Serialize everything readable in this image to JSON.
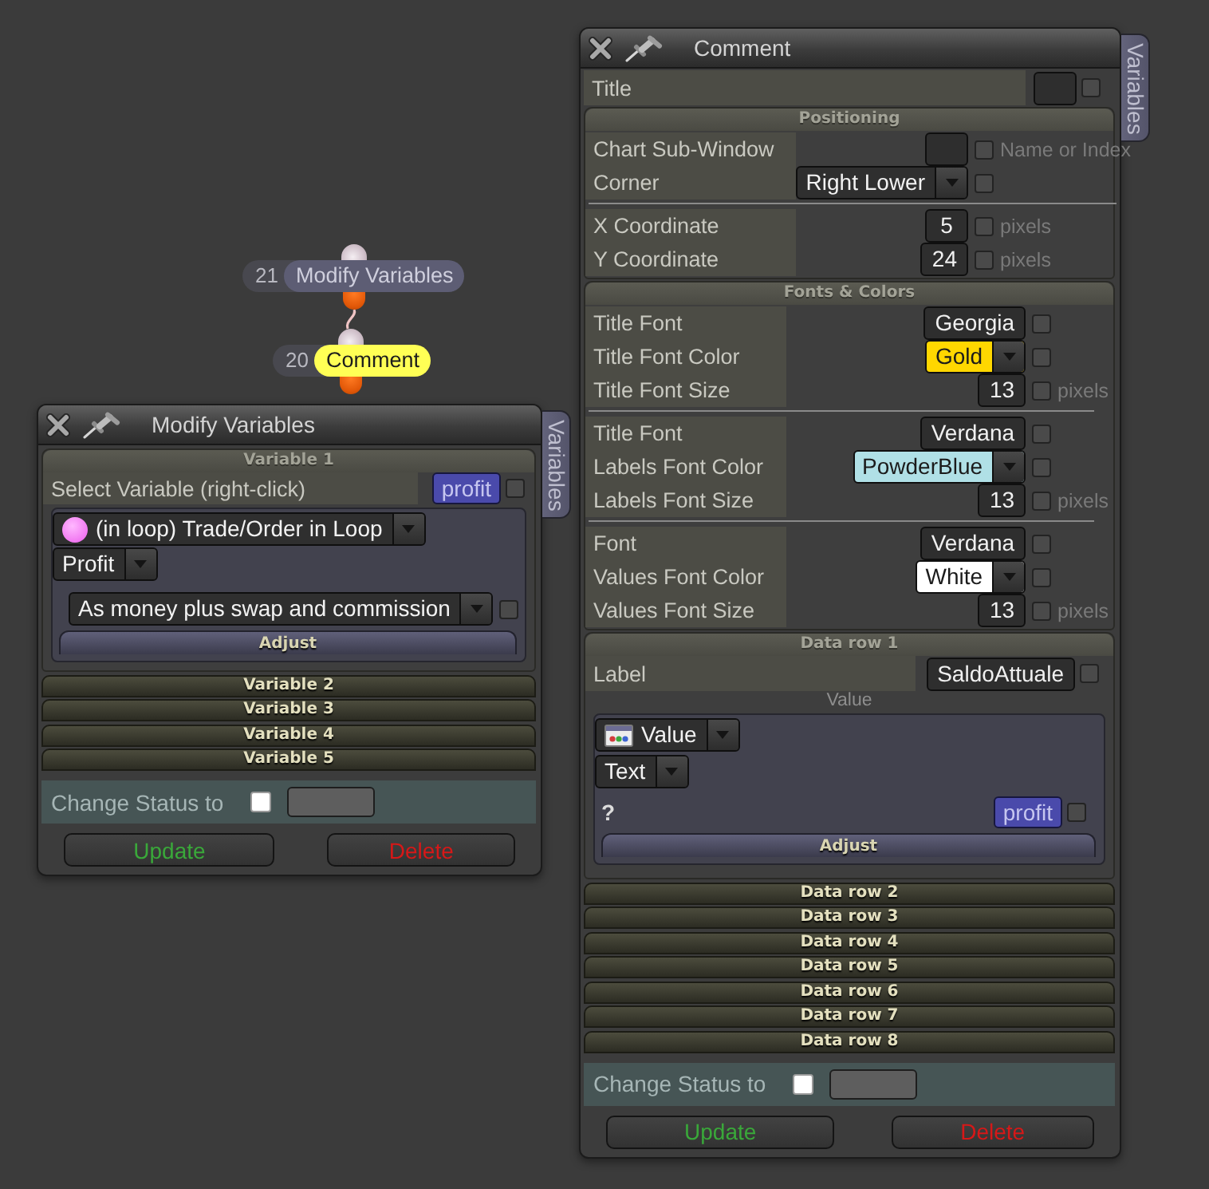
{
  "canvas_nodes": [
    {
      "number": "21",
      "label": "Modify Variables",
      "selected": false
    },
    {
      "number": "20",
      "label": "Comment",
      "selected": true
    }
  ],
  "modify_variables_window": {
    "title": "Modify Variables",
    "side_tab": "Variables",
    "sections": [
      {
        "kind": "variable",
        "title": "Variable 1",
        "expanded": true,
        "select_label": "Select Variable (right-click)",
        "variable": "profit",
        "variable_checked": false,
        "source": "(in loop) Trade/Order in Loop",
        "property": "Profit",
        "mode": "As money plus swap and commission",
        "mode_checked": false,
        "adjust": "Adjust"
      },
      {
        "kind": "variable",
        "title": "Variable 2",
        "expanded": false
      },
      {
        "kind": "variable",
        "title": "Variable 3",
        "expanded": false
      },
      {
        "kind": "variable",
        "title": "Variable 4",
        "expanded": false
      },
      {
        "kind": "variable",
        "title": "Variable 5",
        "expanded": false
      }
    ],
    "status": {
      "label": "Change Status to",
      "checked": false
    },
    "buttons": [
      {
        "label": "Update",
        "kind": "update"
      },
      {
        "label": "Delete",
        "kind": "delete"
      }
    ]
  },
  "comment_window": {
    "title": "Comment",
    "side_tab": "Variables",
    "title_row": {
      "label": "Title",
      "checked": false
    },
    "sections": [
      {
        "kind": "settings",
        "title": "Positioning",
        "expanded": true,
        "groups": [
          {
            "rows": [
              {
                "label": "Chart Sub-Window",
                "kind": "field",
                "note": "Name or Index",
                "checked": false
              },
              {
                "label": "Corner",
                "kind": "dropdown",
                "value": "Right Lower",
                "checked": false
              }
            ]
          },
          {
            "rows": [
              {
                "label": "X Coordinate",
                "kind": "field",
                "value": "5",
                "note": "pixels",
                "checked": false
              },
              {
                "label": "Y Coordinate",
                "kind": "field",
                "value": "24",
                "note": "pixels",
                "checked": false
              }
            ]
          }
        ]
      },
      {
        "kind": "settings",
        "title": "Fonts & Colors",
        "expanded": true,
        "groups": [
          {
            "rows": [
              {
                "label": "Title Font",
                "kind": "field",
                "value": "Georgia",
                "checked": false
              },
              {
                "label": "Title Font Color",
                "kind": "color",
                "value": "Gold",
                "color": "#ffd700",
                "checked": false
              },
              {
                "label": "Title Font Size",
                "kind": "field",
                "value": "13",
                "note": "pixels",
                "checked": false
              }
            ]
          },
          {
            "rows": [
              {
                "label": "Title Font",
                "kind": "field",
                "value": "Verdana",
                "checked": false
              },
              {
                "label": "Labels Font Color",
                "kind": "color",
                "value": "PowderBlue",
                "color": "#b0e0e6",
                "checked": false
              },
              {
                "label": "Labels Font Size",
                "kind": "field",
                "value": "13",
                "note": "pixels",
                "checked": false
              }
            ]
          },
          {
            "rows": [
              {
                "label": "Font",
                "kind": "field",
                "value": "Verdana",
                "checked": false
              },
              {
                "label": "Values Font Color",
                "kind": "color",
                "value": "White",
                "color": "#ffffff",
                "checked": false
              },
              {
                "label": "Values Font Size",
                "kind": "field",
                "value": "13",
                "note": "pixels",
                "checked": false
              }
            ]
          }
        ]
      },
      {
        "kind": "data_row",
        "title": "Data row 1",
        "expanded": true,
        "label_row": {
          "label": "Label",
          "value": "SaldoAttuale",
          "checked": false
        },
        "value_caption": "Value",
        "source": "Value",
        "type": "Text",
        "question": "?",
        "variable": "profit",
        "variable_checked": false,
        "adjust": "Adjust"
      },
      {
        "kind": "data_row",
        "title": "Data row 2",
        "expanded": false
      },
      {
        "kind": "data_row",
        "title": "Data row 3",
        "expanded": false
      },
      {
        "kind": "data_row",
        "title": "Data row 4",
        "expanded": false
      },
      {
        "kind": "data_row",
        "title": "Data row 5",
        "expanded": false
      },
      {
        "kind": "data_row",
        "title": "Data row 6",
        "expanded": false
      },
      {
        "kind": "data_row",
        "title": "Data row 7",
        "expanded": false
      },
      {
        "kind": "data_row",
        "title": "Data row 8",
        "expanded": false
      }
    ],
    "status": {
      "label": "Change Status to",
      "checked": false
    },
    "buttons": [
      {
        "label": "Update",
        "kind": "update"
      },
      {
        "label": "Delete",
        "kind": "delete"
      }
    ]
  }
}
